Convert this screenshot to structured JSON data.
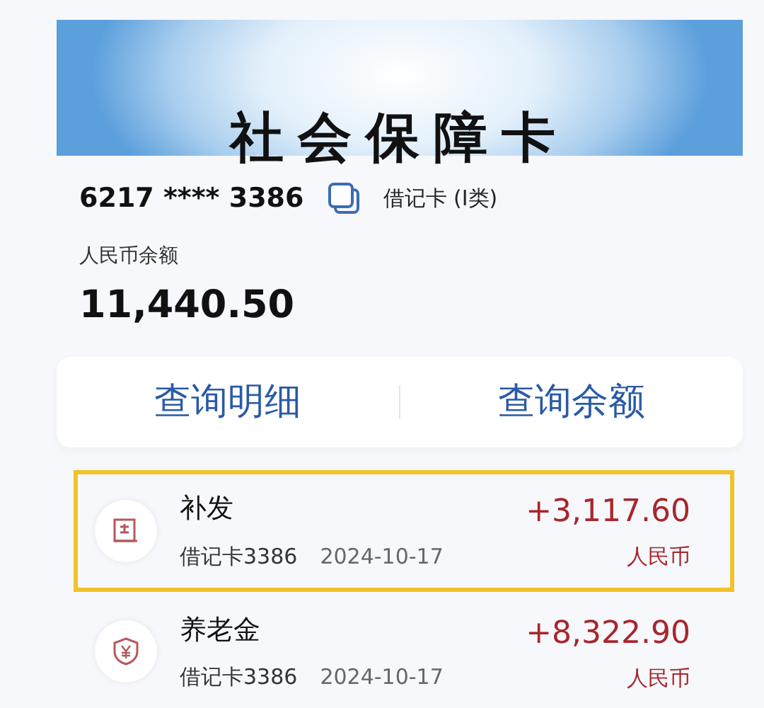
{
  "banner": {
    "title": "社会保障卡"
  },
  "card": {
    "number": "6217 **** 3386",
    "type": "借记卡 (I类)"
  },
  "balance": {
    "label": "人民币余额",
    "amount": "11,440.50"
  },
  "actions": [
    "查询明细",
    "查询余额"
  ],
  "transactions": [
    {
      "kind": "document",
      "title": "补发",
      "account": "借记卡3386",
      "date": "2024-10-17",
      "amount": "+3,117.60",
      "currency": "人民币",
      "selected": true
    },
    {
      "kind": "shield",
      "title": "养老金",
      "account": "借记卡3386",
      "date": "2024-10-17",
      "amount": "+8,322.90",
      "currency": "人民币",
      "selected": false
    }
  ]
}
